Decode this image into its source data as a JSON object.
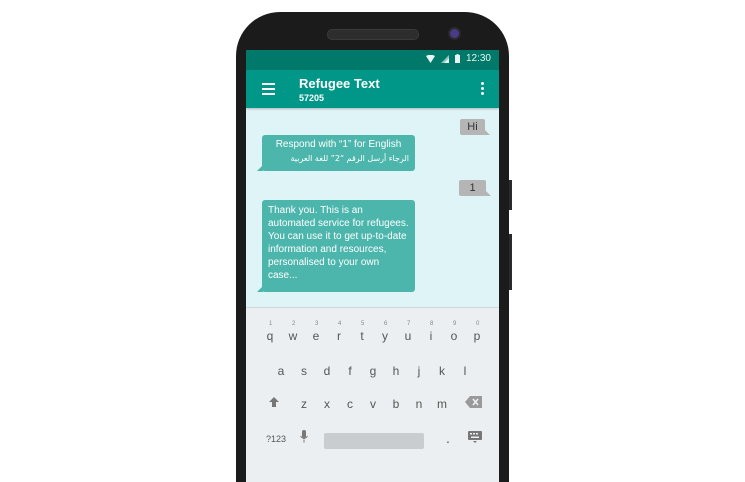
{
  "status": {
    "time": "12:30"
  },
  "app": {
    "title": "Refugee Text",
    "number": "57205"
  },
  "messages": [
    {
      "from": "me",
      "text": "Hi"
    },
    {
      "from": "them",
      "text_en": "Respond with “1” for English",
      "text_ar": "الرجاء أرسل الرقم  “2” للغة العربية"
    },
    {
      "from": "me",
      "text": "1"
    },
    {
      "from": "them",
      "text": "Thank you. This is an automated service for refugees. You can use it to get up-to-date information and resources, personalised to your own case..."
    }
  ],
  "keyboard": {
    "row1": [
      "q",
      "w",
      "e",
      "r",
      "t",
      "y",
      "u",
      "i",
      "o",
      "p"
    ],
    "row1_hints": [
      "1",
      "2",
      "3",
      "4",
      "5",
      "6",
      "7",
      "8",
      "9",
      "0"
    ],
    "row2": [
      "a",
      "s",
      "d",
      "f",
      "g",
      "h",
      "j",
      "k",
      "l"
    ],
    "row3": [
      "z",
      "x",
      "c",
      "v",
      "b",
      "n",
      "m"
    ],
    "symbols_label": "?123",
    "period": "."
  },
  "colors": {
    "appbar": "#009688",
    "statusbar": "#00796b",
    "incoming": "#4db6ac",
    "outgoing": "#b5b5b5"
  }
}
